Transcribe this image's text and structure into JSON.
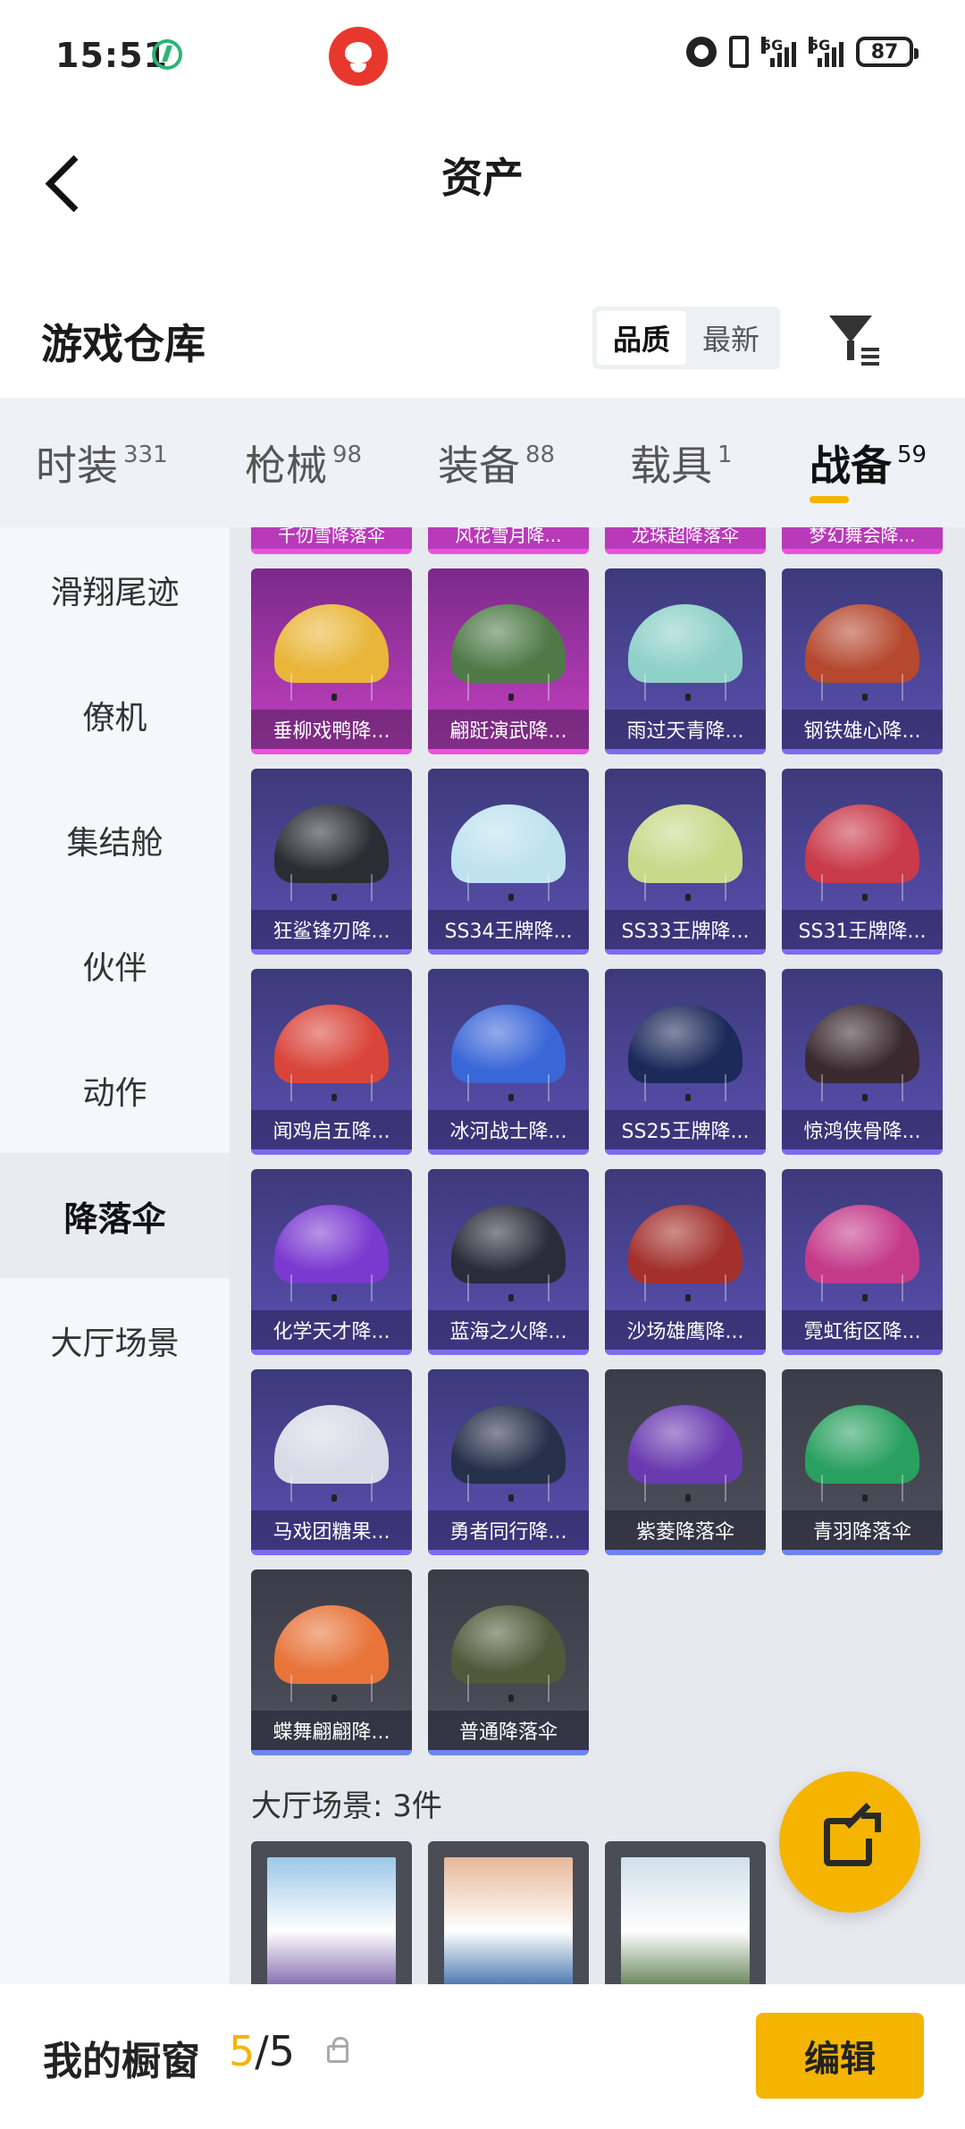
{
  "status_bar": {
    "time": "15:51",
    "network_1": "5G",
    "network_2": "5G",
    "battery": "87"
  },
  "header": {
    "title": "资产"
  },
  "warehouse": {
    "title": "游戏仓库",
    "sort_options": [
      "品质",
      "最新"
    ],
    "active_sort": "品质"
  },
  "tabs": [
    {
      "label": "时装",
      "count": "331"
    },
    {
      "label": "枪械",
      "count": "98"
    },
    {
      "label": "装备",
      "count": "88"
    },
    {
      "label": "载具",
      "count": "1"
    },
    {
      "label": "战备",
      "count": "59"
    }
  ],
  "active_tab": "战备",
  "sidebar": {
    "items": [
      "滑翔尾迹",
      "僚机",
      "集结舱",
      "伙伴",
      "动作",
      "降落伞",
      "大厅场景"
    ],
    "active": "降落伞"
  },
  "partial_row": [
    "千仞雪降落伞",
    "风花雪月降...",
    "龙珠超降落伞",
    "梦幻舞会降..."
  ],
  "items": [
    {
      "name": "垂柳戏鸭降...",
      "rarity": "pink",
      "canopy": "#e9b63a"
    },
    {
      "name": "翩跹演武降...",
      "rarity": "pink",
      "canopy": "#4f7a48"
    },
    {
      "name": "雨过天青降...",
      "rarity": "purple",
      "canopy": "#8fd0c8"
    },
    {
      "name": "钢铁雄心降...",
      "rarity": "purple",
      "canopy": "#b5482f"
    },
    {
      "name": "狂鲨锋刃降...",
      "rarity": "purple",
      "canopy": "#2a2d33"
    },
    {
      "name": "SS34王牌降...",
      "rarity": "purple",
      "canopy": "#bfe2ef"
    },
    {
      "name": "SS33王牌降...",
      "rarity": "purple",
      "canopy": "#c8d98a"
    },
    {
      "name": "SS31王牌降...",
      "rarity": "purple",
      "canopy": "#c93a4a"
    },
    {
      "name": "闻鸡启五降...",
      "rarity": "purple",
      "canopy": "#d9453a"
    },
    {
      "name": "冰河战士降...",
      "rarity": "purple",
      "canopy": "#3a66d8"
    },
    {
      "name": "SS25王牌降...",
      "rarity": "purple",
      "canopy": "#1c2a5a"
    },
    {
      "name": "惊鸿侠骨降...",
      "rarity": "purple",
      "canopy": "#3a2a30"
    },
    {
      "name": "化学天才降...",
      "rarity": "purple",
      "canopy": "#7a3ad0"
    },
    {
      "name": "蓝海之火降...",
      "rarity": "purple",
      "canopy": "#2a2c3a"
    },
    {
      "name": "沙场雄鹰降...",
      "rarity": "purple",
      "canopy": "#a3302c"
    },
    {
      "name": "霓虹街区降...",
      "rarity": "purple",
      "canopy": "#c43a8a"
    },
    {
      "name": "马戏团糖果...",
      "rarity": "purple",
      "canopy": "#d8dbe6"
    },
    {
      "name": "勇者同行降...",
      "rarity": "purple",
      "canopy": "#26304a"
    },
    {
      "name": "紫菱降落伞",
      "rarity": "gray",
      "canopy": "#6a3ab0"
    },
    {
      "name": "青羽降落伞",
      "rarity": "gray",
      "canopy": "#2aa060"
    },
    {
      "name": "蝶舞翩翩降...",
      "rarity": "gray",
      "canopy": "#e8743a"
    },
    {
      "name": "普通降落伞",
      "rarity": "gray",
      "canopy": "#4f5a3a"
    }
  ],
  "lobby_section": {
    "title": "大厅场景: 3件",
    "scenes": [
      {
        "name": "scene-1",
        "sky": "#9cc8e8",
        "ground": "#7a5fa8"
      },
      {
        "name": "scene-2",
        "sky": "#e8b89a",
        "ground": "#3a6aa8"
      },
      {
        "name": "scene-3",
        "sky": "#cfe0ea",
        "ground": "#5a7a4a"
      }
    ]
  },
  "bottom_bar": {
    "title": "我的橱窗",
    "current": "5",
    "separator": "/5",
    "edit_label": "编辑"
  },
  "colors": {
    "accent": "#f5b400",
    "rarity_pink": "#e852e0",
    "rarity_purple": "#7b6cf0",
    "rarity_blue": "#6a85ee"
  },
  "icons": {
    "back": "chevron-left-icon",
    "filter": "filter-icon",
    "share": "share-external-icon",
    "lock": "lock-icon"
  }
}
